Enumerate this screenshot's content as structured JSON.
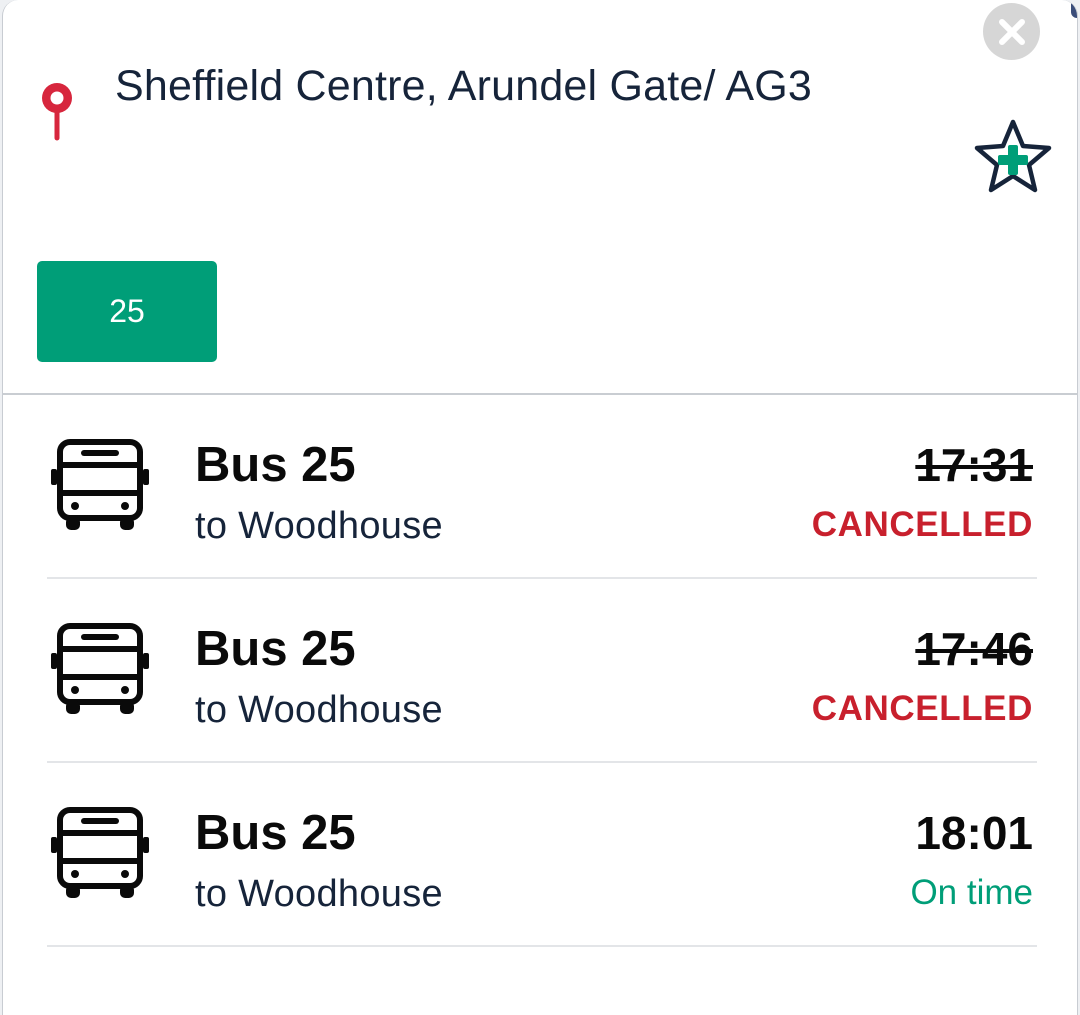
{
  "stop": {
    "name": "Sheffield Centre, Arundel Gate/ AG3",
    "pin_icon": "map-pin-icon",
    "favourite_icon": "star-plus-icon",
    "close_icon": "close-icon"
  },
  "route_filter": {
    "selected": "25"
  },
  "departures": [
    {
      "bus": "Bus 25",
      "destination": "to Woodhouse",
      "time": "17:31",
      "status": "CANCELLED",
      "cancelled": true
    },
    {
      "bus": "Bus 25",
      "destination": "to Woodhouse",
      "time": "17:46",
      "status": "CANCELLED",
      "cancelled": true
    },
    {
      "bus": "Bus 25",
      "destination": "to Woodhouse",
      "time": "18:01",
      "status": "On time",
      "cancelled": false
    }
  ],
  "colors": {
    "accent_green": "#009e78",
    "cancelled_red": "#c8202d",
    "pin_red": "#d7263d",
    "title_navy": "#16243a"
  }
}
